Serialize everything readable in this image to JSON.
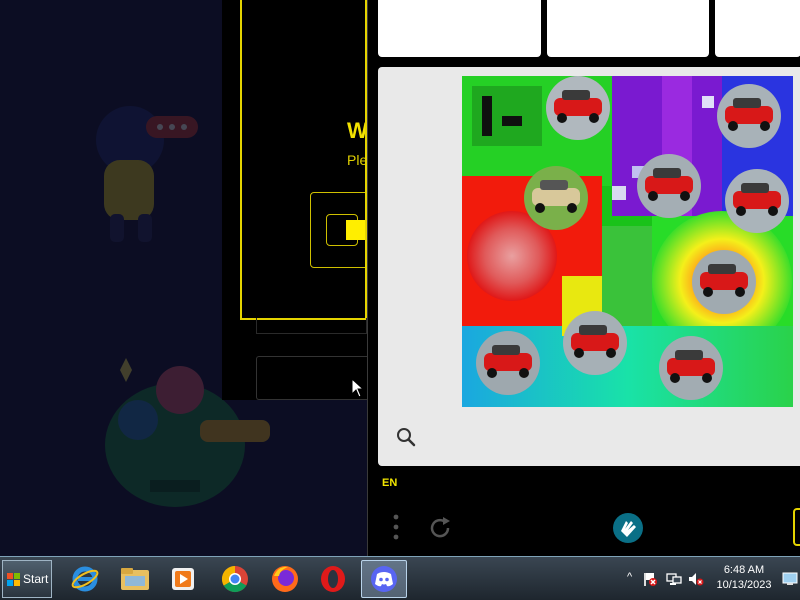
{
  "background_site": {
    "modal_title": "W",
    "modal_subtitle": "Ple"
  },
  "captcha": {
    "language": "EN",
    "icons": {
      "zoom": "magnifier-icon",
      "menu": "vertical-dots-icon",
      "refresh": "refresh-icon",
      "brand": "hand-logo-icon",
      "submit": "submit-button-edge"
    },
    "accent_color": "#e5d400"
  },
  "taskbar": {
    "start_label": "Start",
    "apps": [
      "internet-explorer-icon",
      "file-explorer-icon",
      "media-player-icon",
      "chrome-icon",
      "firefox-icon",
      "opera-icon",
      "discord-icon"
    ],
    "active_app": "discord-icon",
    "tray_icons": [
      "show-hidden-icons",
      "action-center-flag-icon",
      "network-icon",
      "volume-muted-icon"
    ],
    "clock": {
      "time": "6:48 AM",
      "date": "10/13/2023"
    }
  }
}
